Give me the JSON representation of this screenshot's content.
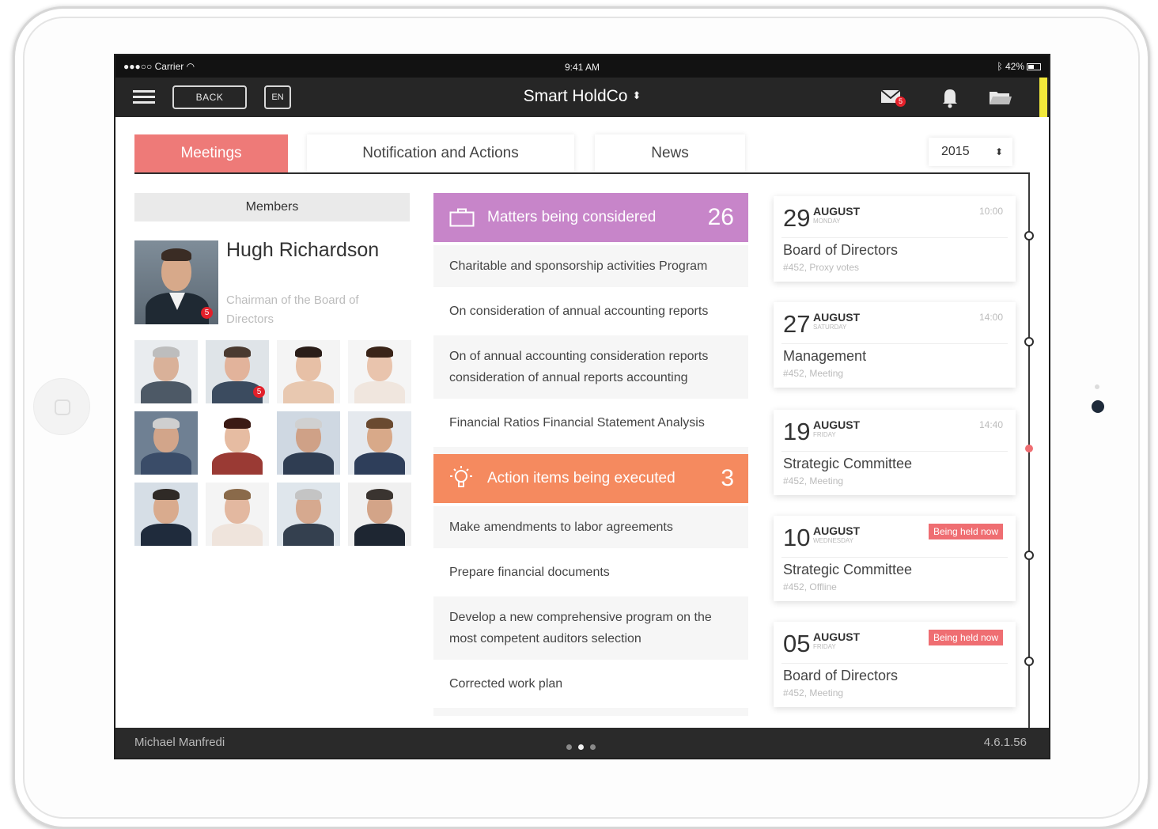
{
  "statusbar": {
    "carrier": "●●●○○ Carrier",
    "time": "9:41 AM",
    "battery": "42%"
  },
  "navbar": {
    "back_label": "BACK",
    "lang_label": "EN",
    "title": "Smart HoldCo",
    "title_arrows": "⬍",
    "mail_badge": "5",
    "icons": [
      "menu-icon",
      "mail-icon",
      "bell-icon",
      "folder-icon"
    ]
  },
  "tabs": [
    {
      "label": "Meetings",
      "active": true
    },
    {
      "label": "Notification and Actions",
      "active": false
    },
    {
      "label": "News",
      "active": false
    }
  ],
  "year": {
    "value": "2015",
    "arrows": "⬍"
  },
  "members": {
    "header": "Members",
    "featured": {
      "name": "Hugh Richardson",
      "role": "Chairman of the Board of Directors",
      "badge": "5"
    },
    "grid_badge": "5"
  },
  "matters": {
    "title": "Matters being considered",
    "count": "26",
    "color": "#c785c9",
    "items": [
      "Charitable and sponsorship activities Program",
      "On consideration of annual accounting reports",
      "On of annual accounting consideration reports consideration of annual reports accounting",
      "Financial Ratios Financial Statement Analysis"
    ]
  },
  "actions": {
    "title": "Action items being executed",
    "count": "3",
    "color": "#f58a5f",
    "items": [
      "Make amendments to labor agreements",
      "Prepare financial documents",
      "Develop a new comprehensive program on the most competent auditors selection",
      "Corrected work plan"
    ]
  },
  "meetings": [
    {
      "day": "29",
      "month": "AUGUST",
      "weekday": "Monday",
      "time": "10:00",
      "status": "",
      "title": "Board of Directors",
      "sub": "#452, Proxy votes"
    },
    {
      "day": "27",
      "month": "AUGUST",
      "weekday": "Saturday",
      "time": "14:00",
      "status": "",
      "title": "Management",
      "sub": "#452, Meeting"
    },
    {
      "day": "19",
      "month": "AUGUST",
      "weekday": "Friday",
      "time": "14:40",
      "status": "",
      "title": "Strategic Committee",
      "sub": "#452, Meeting"
    },
    {
      "day": "10",
      "month": "AUGUST",
      "weekday": "Wednesday",
      "time": "",
      "status": "Being held now",
      "title": "Strategic Committee",
      "sub": "#452, Offline"
    },
    {
      "day": "05",
      "month": "AUGUST",
      "weekday": "Friday",
      "time": "",
      "status": "Being held now",
      "title": "Board of Directors",
      "sub": "#452, Meeting"
    }
  ],
  "footer": {
    "user": "Michael Manfredi",
    "version": "4.6.1.56",
    "pages": 3,
    "current_page": 2
  },
  "colors": {
    "accent_tab": "#ee7a78",
    "live_badge": "#ef6e72",
    "navbar": "#262626",
    "accent_strip": "#f2e93a"
  }
}
